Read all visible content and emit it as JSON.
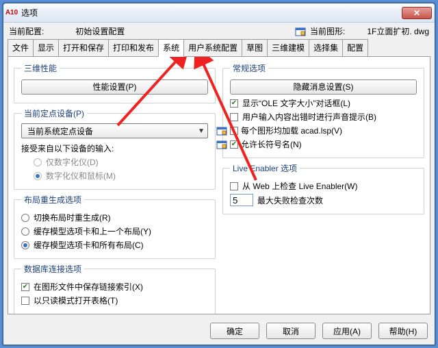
{
  "window": {
    "title": "选项",
    "appicon": "A10"
  },
  "header": {
    "profile_label": "当前配置:",
    "profile_value": "初始设置配置",
    "drawing_label": "当前图形:",
    "drawing_value": "1F立面扩初. dwg"
  },
  "tabs": {
    "items": [
      "文件",
      "显示",
      "打开和保存",
      "打印和发布",
      "系统",
      "用户系统配置",
      "草图",
      "三维建模",
      "选择集",
      "配置"
    ],
    "active_index": 4
  },
  "left": {
    "perf3d": {
      "legend": "三维性能",
      "button": "性能设置(P)"
    },
    "pointing": {
      "legend": "当前定点设备(P)",
      "select": "当前系统定点设备",
      "accept_label": "接受来自以下设备的输入:",
      "opt_digitizer": "仅数字化仪(D)",
      "opt_both": "数字化仪和鼠标(M)"
    },
    "regen": {
      "legend": "布局重生成选项",
      "opt_switch": "切换布局时重生成(R)",
      "opt_cache_last": "缓存模型选项卡和上一个布局(Y)",
      "opt_cache_all": "缓存模型选项卡和所有布局(C)"
    },
    "db": {
      "legend": "数据库连接选项",
      "chk_store": "在图形文件中保存链接索引(X)",
      "chk_readonly": "以只读模式打开表格(T)"
    }
  },
  "right": {
    "general": {
      "legend": "常规选项",
      "button": "隐藏消息设置(S)",
      "chk_ole": "显示“OLE 文字大小”对话框(L)",
      "chk_beep": "用户输入内容出错时进行声音提示(B)",
      "chk_acadlsp": "每个图形均加载 acad.lsp(V)",
      "chk_longnames": "允许长符号名(N)"
    },
    "live": {
      "legend": "Live Enabler 选项",
      "chk_web": "从 Web 上检查 Live Enabler(W)",
      "fail_value": "5",
      "fail_label": "最大失败检查次数"
    }
  },
  "buttons": {
    "ok": "确定",
    "cancel": "取消",
    "apply": "应用(A)",
    "help": "帮助(H)"
  }
}
